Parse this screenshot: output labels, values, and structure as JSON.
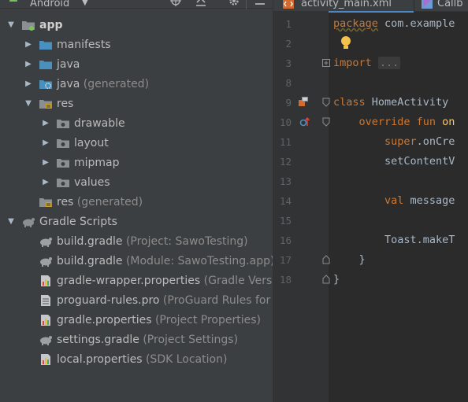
{
  "project": {
    "view_title": "Android",
    "tree": [
      {
        "label": "app",
        "hint": "",
        "bold": true,
        "arrow": "down",
        "icon": "app-module-icon"
      },
      {
        "label": "manifests",
        "hint": "",
        "arrow": "right",
        "icon": "folder-icon"
      },
      {
        "label": "java",
        "hint": "",
        "arrow": "right",
        "icon": "folder-icon"
      },
      {
        "label": "java",
        "hint": "(generated)",
        "arrow": "right",
        "icon": "generated-folder-icon"
      },
      {
        "label": "res",
        "hint": "",
        "arrow": "down",
        "icon": "res-folder-icon"
      },
      {
        "label": "drawable",
        "hint": "",
        "arrow": "right",
        "icon": "res-subfolder-icon"
      },
      {
        "label": "layout",
        "hint": "",
        "arrow": "right",
        "icon": "res-subfolder-icon"
      },
      {
        "label": "mipmap",
        "hint": "",
        "arrow": "right",
        "icon": "res-subfolder-icon"
      },
      {
        "label": "values",
        "hint": "",
        "arrow": "right",
        "icon": "res-subfolder-icon"
      },
      {
        "label": "res",
        "hint": "(generated)",
        "arrow": "",
        "icon": "res-folder-icon"
      },
      {
        "label": "Gradle Scripts",
        "hint": "",
        "arrow": "down",
        "icon": "gradle-icon"
      },
      {
        "label": "build.gradle",
        "hint": "(Project: SawoTesting)",
        "arrow": "",
        "icon": "gradle-file-icon"
      },
      {
        "label": "build.gradle",
        "hint": "(Module: SawoTesting.app)",
        "arrow": "",
        "icon": "gradle-file-icon"
      },
      {
        "label": "gradle-wrapper.properties",
        "hint": "(Gradle Versio",
        "arrow": "",
        "icon": "properties-file-icon"
      },
      {
        "label": "proguard-rules.pro",
        "hint": "(ProGuard Rules for S",
        "arrow": "",
        "icon": "text-file-icon"
      },
      {
        "label": "gradle.properties",
        "hint": "(Project Properties)",
        "arrow": "",
        "icon": "properties-file-icon"
      },
      {
        "label": "settings.gradle",
        "hint": "(Project Settings)",
        "arrow": "",
        "icon": "gradle-file-icon"
      },
      {
        "label": "local.properties",
        "hint": "(SDK Location)",
        "arrow": "",
        "icon": "properties-file-icon"
      }
    ]
  },
  "editor": {
    "tabs": [
      {
        "label": "activity_main.xml"
      },
      {
        "label": "Callb"
      }
    ],
    "lines": [
      {
        "num": "1",
        "segments": [
          {
            "t": "package",
            "c": "kw"
          },
          {
            "t": " com.example",
            "c": ""
          }
        ]
      },
      {
        "num": "2",
        "segments": []
      },
      {
        "num": "3",
        "segments": [
          {
            "t": "import",
            "c": "kw"
          },
          {
            "t": " ",
            "c": ""
          },
          {
            "t": "...",
            "c": "folded"
          }
        ]
      },
      {
        "num": "8",
        "segments": []
      },
      {
        "num": "9",
        "segments": [
          {
            "t": "class",
            "c": "kw"
          },
          {
            "t": " HomeActivity",
            "c": ""
          }
        ]
      },
      {
        "num": "10",
        "segments": [
          {
            "t": "    override fun ",
            "c": "kw"
          },
          {
            "t": "on",
            "c": "fn"
          }
        ]
      },
      {
        "num": "11",
        "segments": [
          {
            "t": "        super",
            "c": "kw"
          },
          {
            "t": ".onCre",
            "c": ""
          }
        ]
      },
      {
        "num": "12",
        "segments": [
          {
            "t": "        setContentV",
            "c": ""
          }
        ]
      },
      {
        "num": "13",
        "segments": []
      },
      {
        "num": "14",
        "segments": [
          {
            "t": "        val",
            "c": "kw"
          },
          {
            "t": " message",
            "c": ""
          }
        ]
      },
      {
        "num": "15",
        "segments": []
      },
      {
        "num": "16",
        "segments": [
          {
            "t": "        Toast.makeT",
            "c": ""
          }
        ]
      },
      {
        "num": "17",
        "segments": [
          {
            "t": "    }",
            "c": ""
          }
        ]
      },
      {
        "num": "18",
        "segments": [
          {
            "t": "}",
            "c": ""
          }
        ]
      }
    ]
  },
  "colors": {
    "panel_bg": "#3c3f41",
    "editor_bg": "#2b2b2b",
    "gutter_bg": "#313335",
    "keyword": "#cc7832",
    "function": "#ffc66d",
    "text": "#a9b7c6"
  }
}
